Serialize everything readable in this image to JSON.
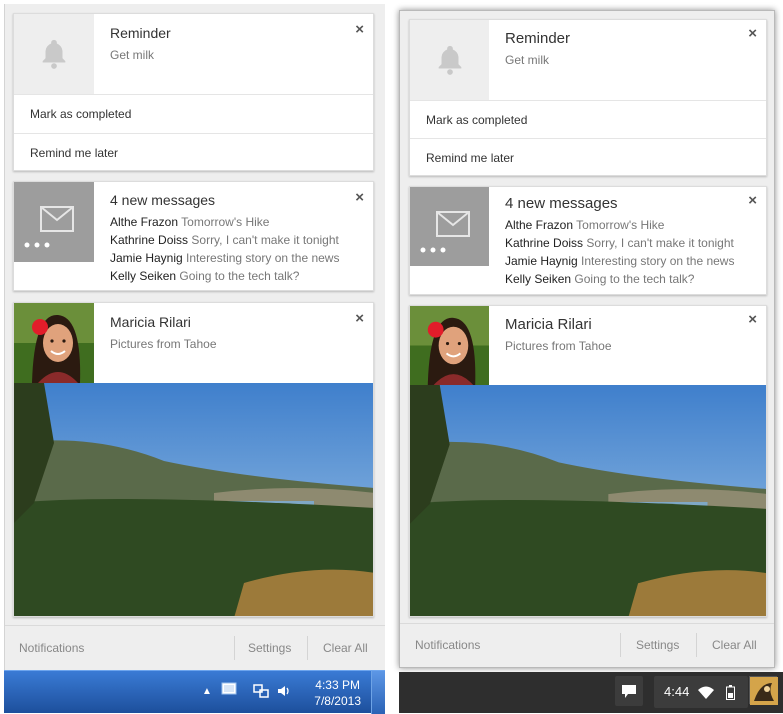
{
  "windows": {
    "reminder": {
      "title": "Reminder",
      "body": "Get milk",
      "close": "×",
      "actions": [
        "Mark as completed",
        "Remind me later"
      ]
    },
    "gmail": {
      "title": "4 new messages",
      "close": "×",
      "messages": [
        {
          "sender": "Althe Frazon",
          "subject": "Tomorrow's Hike"
        },
        {
          "sender": "Kathrine Doiss",
          "subject": "Sorry, I can't make it tonight"
        },
        {
          "sender": "Jamie Haynig",
          "subject": "Interesting story on the news"
        },
        {
          "sender": "Kelly Seiken",
          "subject": "Going to the tech talk?"
        }
      ]
    },
    "photo": {
      "title": "Maricia Rilari",
      "body": "Pictures from Tahoe",
      "close": "×"
    },
    "footer": {
      "notifications": "Notifications",
      "settings": "Settings",
      "clear_all": "Clear All"
    },
    "taskbar": {
      "time": "4:33 PM",
      "date": "7/8/2013"
    }
  },
  "chromeos": {
    "reminder": {
      "title": "Reminder",
      "body": "Get milk",
      "close": "×",
      "actions": [
        "Mark as completed",
        "Remind me later"
      ]
    },
    "gmail": {
      "title": "4 new messages",
      "close": "×",
      "messages": [
        {
          "sender": "Althe Frazon",
          "subject": "Tomorrow's Hike"
        },
        {
          "sender": "Kathrine Doiss",
          "subject": "Sorry, I can't make it tonight"
        },
        {
          "sender": "Jamie Haynig",
          "subject": "Interesting story on the news"
        },
        {
          "sender": "Kelly Seiken",
          "subject": "Going to the tech talk?"
        }
      ]
    },
    "photo": {
      "title": "Maricia Rilari",
      "body": "Pictures from Tahoe",
      "close": "×"
    },
    "footer": {
      "notifications": "Notifications",
      "settings": "Settings",
      "clear_all": "Clear All"
    },
    "shelf": {
      "time": "4:44"
    }
  },
  "icons": {
    "reminder": "bell-icon",
    "gmail": "mail-icon",
    "overflow": "more-dots-icon",
    "close": "close-icon",
    "notification_tray": "notification-icon",
    "wifi": "wifi-icon",
    "battery": "battery-icon",
    "network": "network-icon",
    "volume": "volume-icon",
    "show_hidden": "chevron-up-icon"
  },
  "colors": {
    "panel_bg": "#eeeeee",
    "card_bg": "#ffffff",
    "icon_gray": "#c9c9c9",
    "gmail_tile": "#9d9d9d",
    "win_taskbar": "#2a62b5",
    "cros_shelf": "#2e2e2e"
  }
}
